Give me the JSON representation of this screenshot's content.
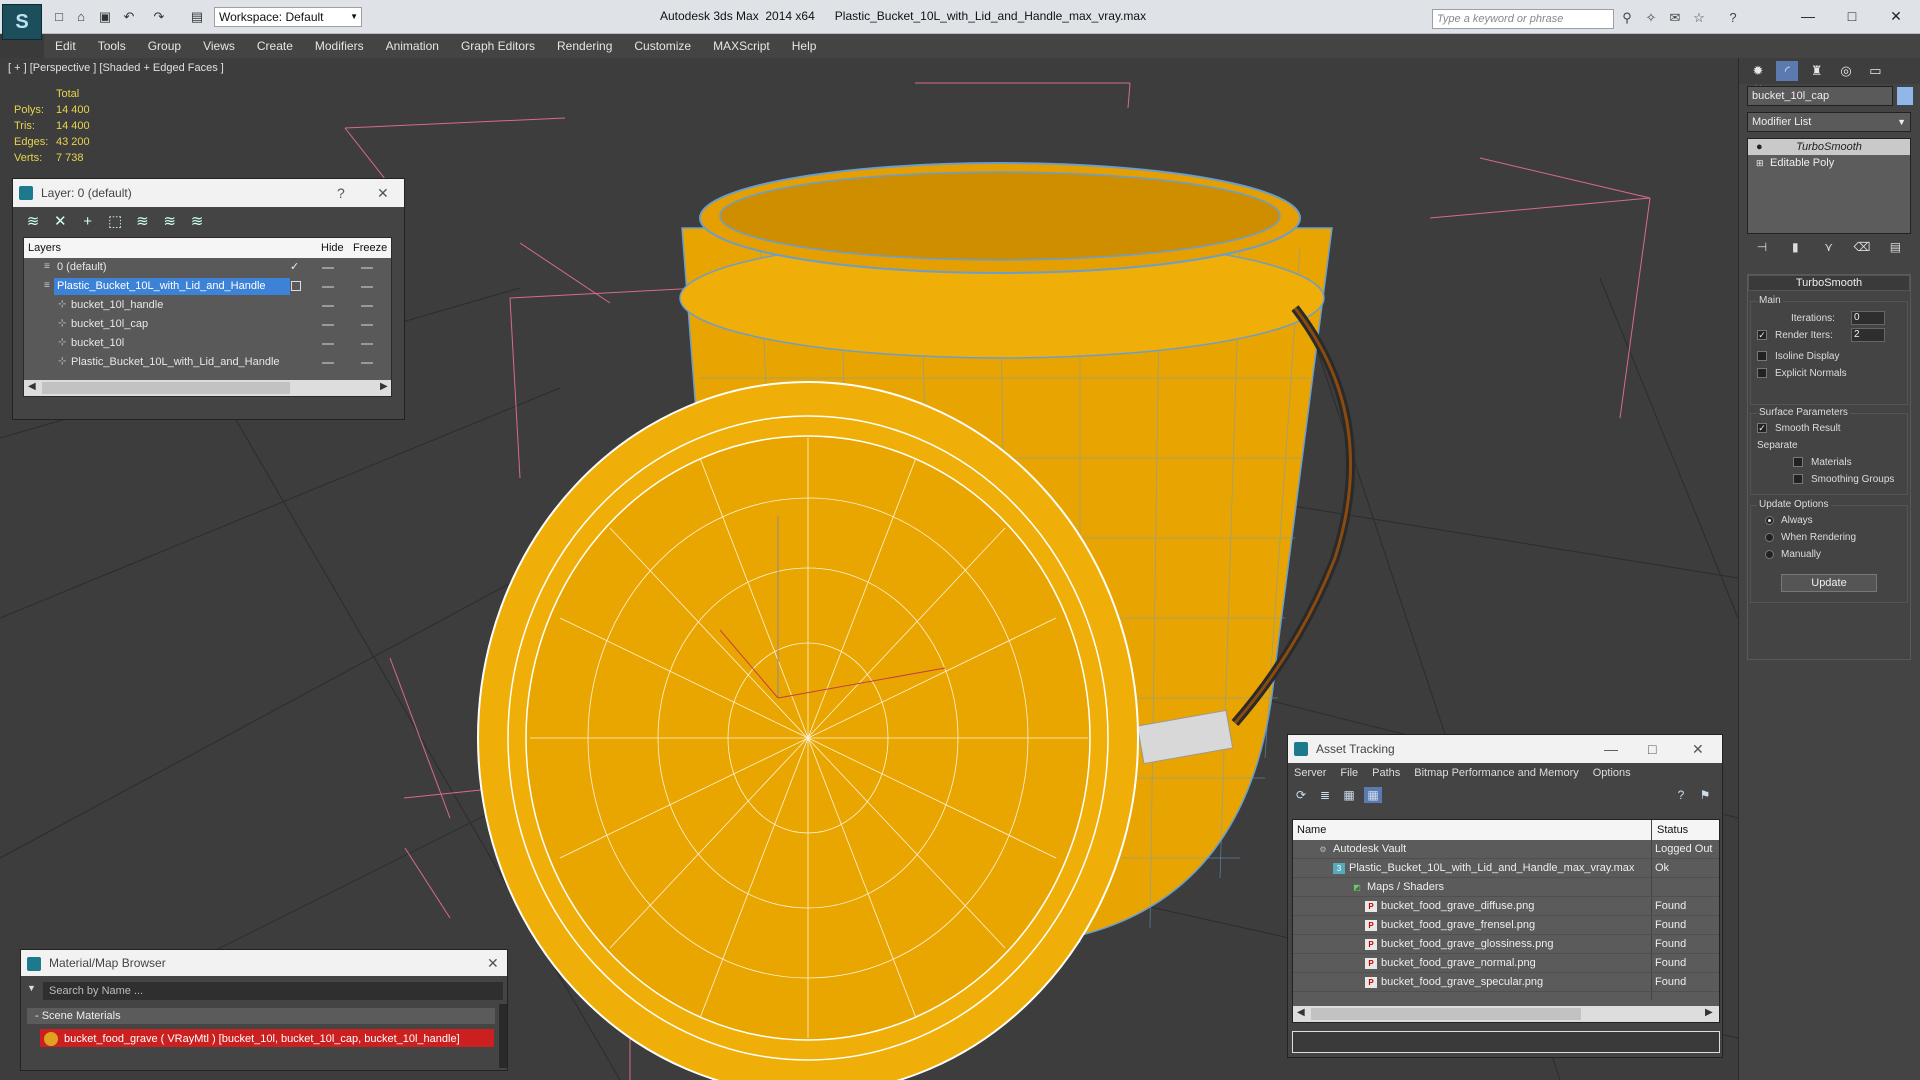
{
  "titlebar": {
    "app": "Autodesk 3ds Max  2014 x64",
    "file": "Plastic_Bucket_10L_with_Lid_and_Handle_max_vray.max",
    "workspace": "Workspace: Default",
    "search_placeholder": "Type a keyword or phrase"
  },
  "menu": [
    "Edit",
    "Tools",
    "Group",
    "Views",
    "Create",
    "Modifiers",
    "Animation",
    "Graph Editors",
    "Rendering",
    "Customize",
    "MAXScript",
    "Help"
  ],
  "viewport": {
    "label": "[ + ] [Perspective ] [Shaded + Edged Faces ]",
    "stats_header": "Total",
    "stats": [
      {
        "label": "Polys:",
        "value": "14 400"
      },
      {
        "label": "Tris:",
        "value": "14 400"
      },
      {
        "label": "Edges:",
        "value": "43 200"
      },
      {
        "label": "Verts:",
        "value": "7 738"
      }
    ],
    "object_color": "#f0a800"
  },
  "layer_dialog": {
    "title": "Layer: 0 (default)",
    "help": "?",
    "col_layers": "Layers",
    "col_hide": "Hide",
    "col_freeze": "Freeze",
    "rows": [
      {
        "name": "0 (default)"
      },
      {
        "name": "Plastic_Bucket_10L_with_Lid_and_Handle"
      },
      {
        "name": "bucket_10l_handle"
      },
      {
        "name": "bucket_10l_cap"
      },
      {
        "name": "bucket_10l"
      },
      {
        "name": "Plastic_Bucket_10L_with_Lid_and_Handle"
      }
    ]
  },
  "command_panel": {
    "object_name": "bucket_10l_cap",
    "modifier_list": "Modifier List",
    "stack": [
      "TurboSmooth",
      "Editable Poly"
    ],
    "rollout_title": "TurboSmooth",
    "main_label": "Main",
    "iterations_label": "Iterations:",
    "iterations_value": "0",
    "render_iters_label": "Render Iters:",
    "render_iters_value": "2",
    "isoline": "Isoline Display",
    "explicit": "Explicit Normals",
    "surface_label": "Surface Parameters",
    "smooth_result": "Smooth Result",
    "separate_label": "Separate",
    "materials": "Materials",
    "smoothing_groups": "Smoothing Groups",
    "update_options": "Update Options",
    "always": "Always",
    "when_rendering": "When Rendering",
    "manually": "Manually",
    "update_button": "Update"
  },
  "asset_tracking": {
    "title": "Asset Tracking",
    "menu": [
      "Server",
      "File",
      "Paths",
      "Bitmap Performance and Memory",
      "Options"
    ],
    "col_name": "Name",
    "col_status": "Status",
    "rows": [
      {
        "name": "Autodesk Vault",
        "status": "Logged Out"
      },
      {
        "name": "Plastic_Bucket_10L_with_Lid_and_Handle_max_vray.max",
        "status": "Ok"
      },
      {
        "name": "Maps / Shaders",
        "status": ""
      },
      {
        "name": "bucket_food_grave_diffuse.png",
        "status": "Found"
      },
      {
        "name": "bucket_food_grave_frensel.png",
        "status": "Found"
      },
      {
        "name": "bucket_food_grave_glossiness.png",
        "status": "Found"
      },
      {
        "name": "bucket_food_grave_normal.png",
        "status": "Found"
      },
      {
        "name": "bucket_food_grave_specular.png",
        "status": "Found"
      }
    ]
  },
  "material_browser": {
    "title": "Material/Map Browser",
    "search": "Search by Name ...",
    "section": "- Scene Materials",
    "item": "bucket_food_grave  ( VRayMtl )  [bucket_10l, bucket_10l_cap, bucket_10l_handle]"
  }
}
